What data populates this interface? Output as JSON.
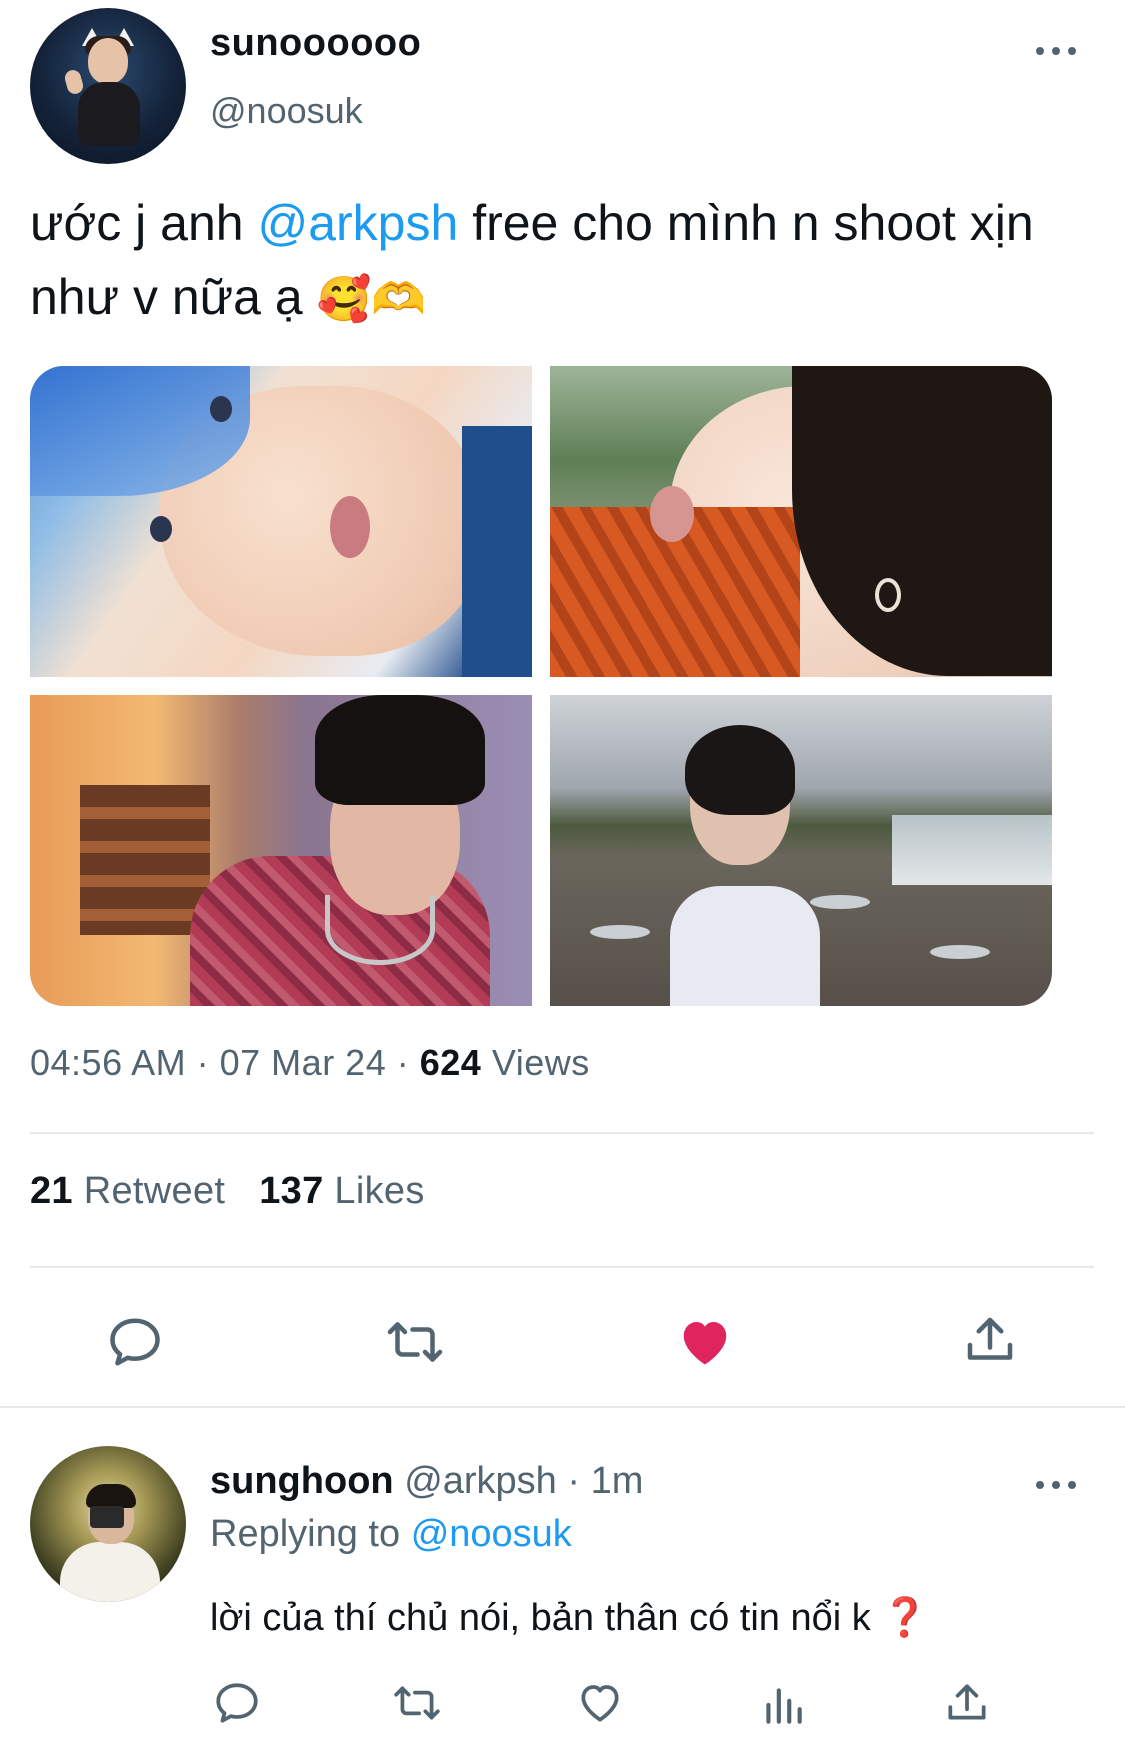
{
  "tweet": {
    "display_name": "sunoooooo",
    "handle": "@noosuk",
    "text_before": "ước j anh ",
    "mention": "@arkpsh",
    "text_after": " free cho mình n shoot xịn như v nữa ạ ",
    "emoji_1": "🥰",
    "emoji_2": "🫶",
    "time": "04:56 AM",
    "sep": "·",
    "date": "07 Mar 24",
    "views_count": "624",
    "views_label": "Views",
    "retweet_count": "21",
    "retweet_label": "Retweet",
    "likes_count": "137",
    "likes_label": "Likes",
    "liked": true,
    "icons": [
      "reply-icon",
      "retweet-icon",
      "like-icon-filled",
      "share-icon"
    ]
  },
  "colors": {
    "link": "#1d9bf0",
    "secondary": "#536471",
    "like": "#e0245e",
    "divider": "#e6e9ec"
  },
  "reply": {
    "display_name": "sunghoon",
    "handle": "@arkpsh",
    "sep": "·",
    "time": "1m",
    "replying_label": "Replying to",
    "replying_to": "@noosuk",
    "text": "lời của thí chủ nói, bản thân có tin nổi k",
    "emoji": "❓",
    "icons": [
      "reply-icon",
      "retweet-icon",
      "like-icon",
      "views-icon",
      "share-icon"
    ]
  }
}
